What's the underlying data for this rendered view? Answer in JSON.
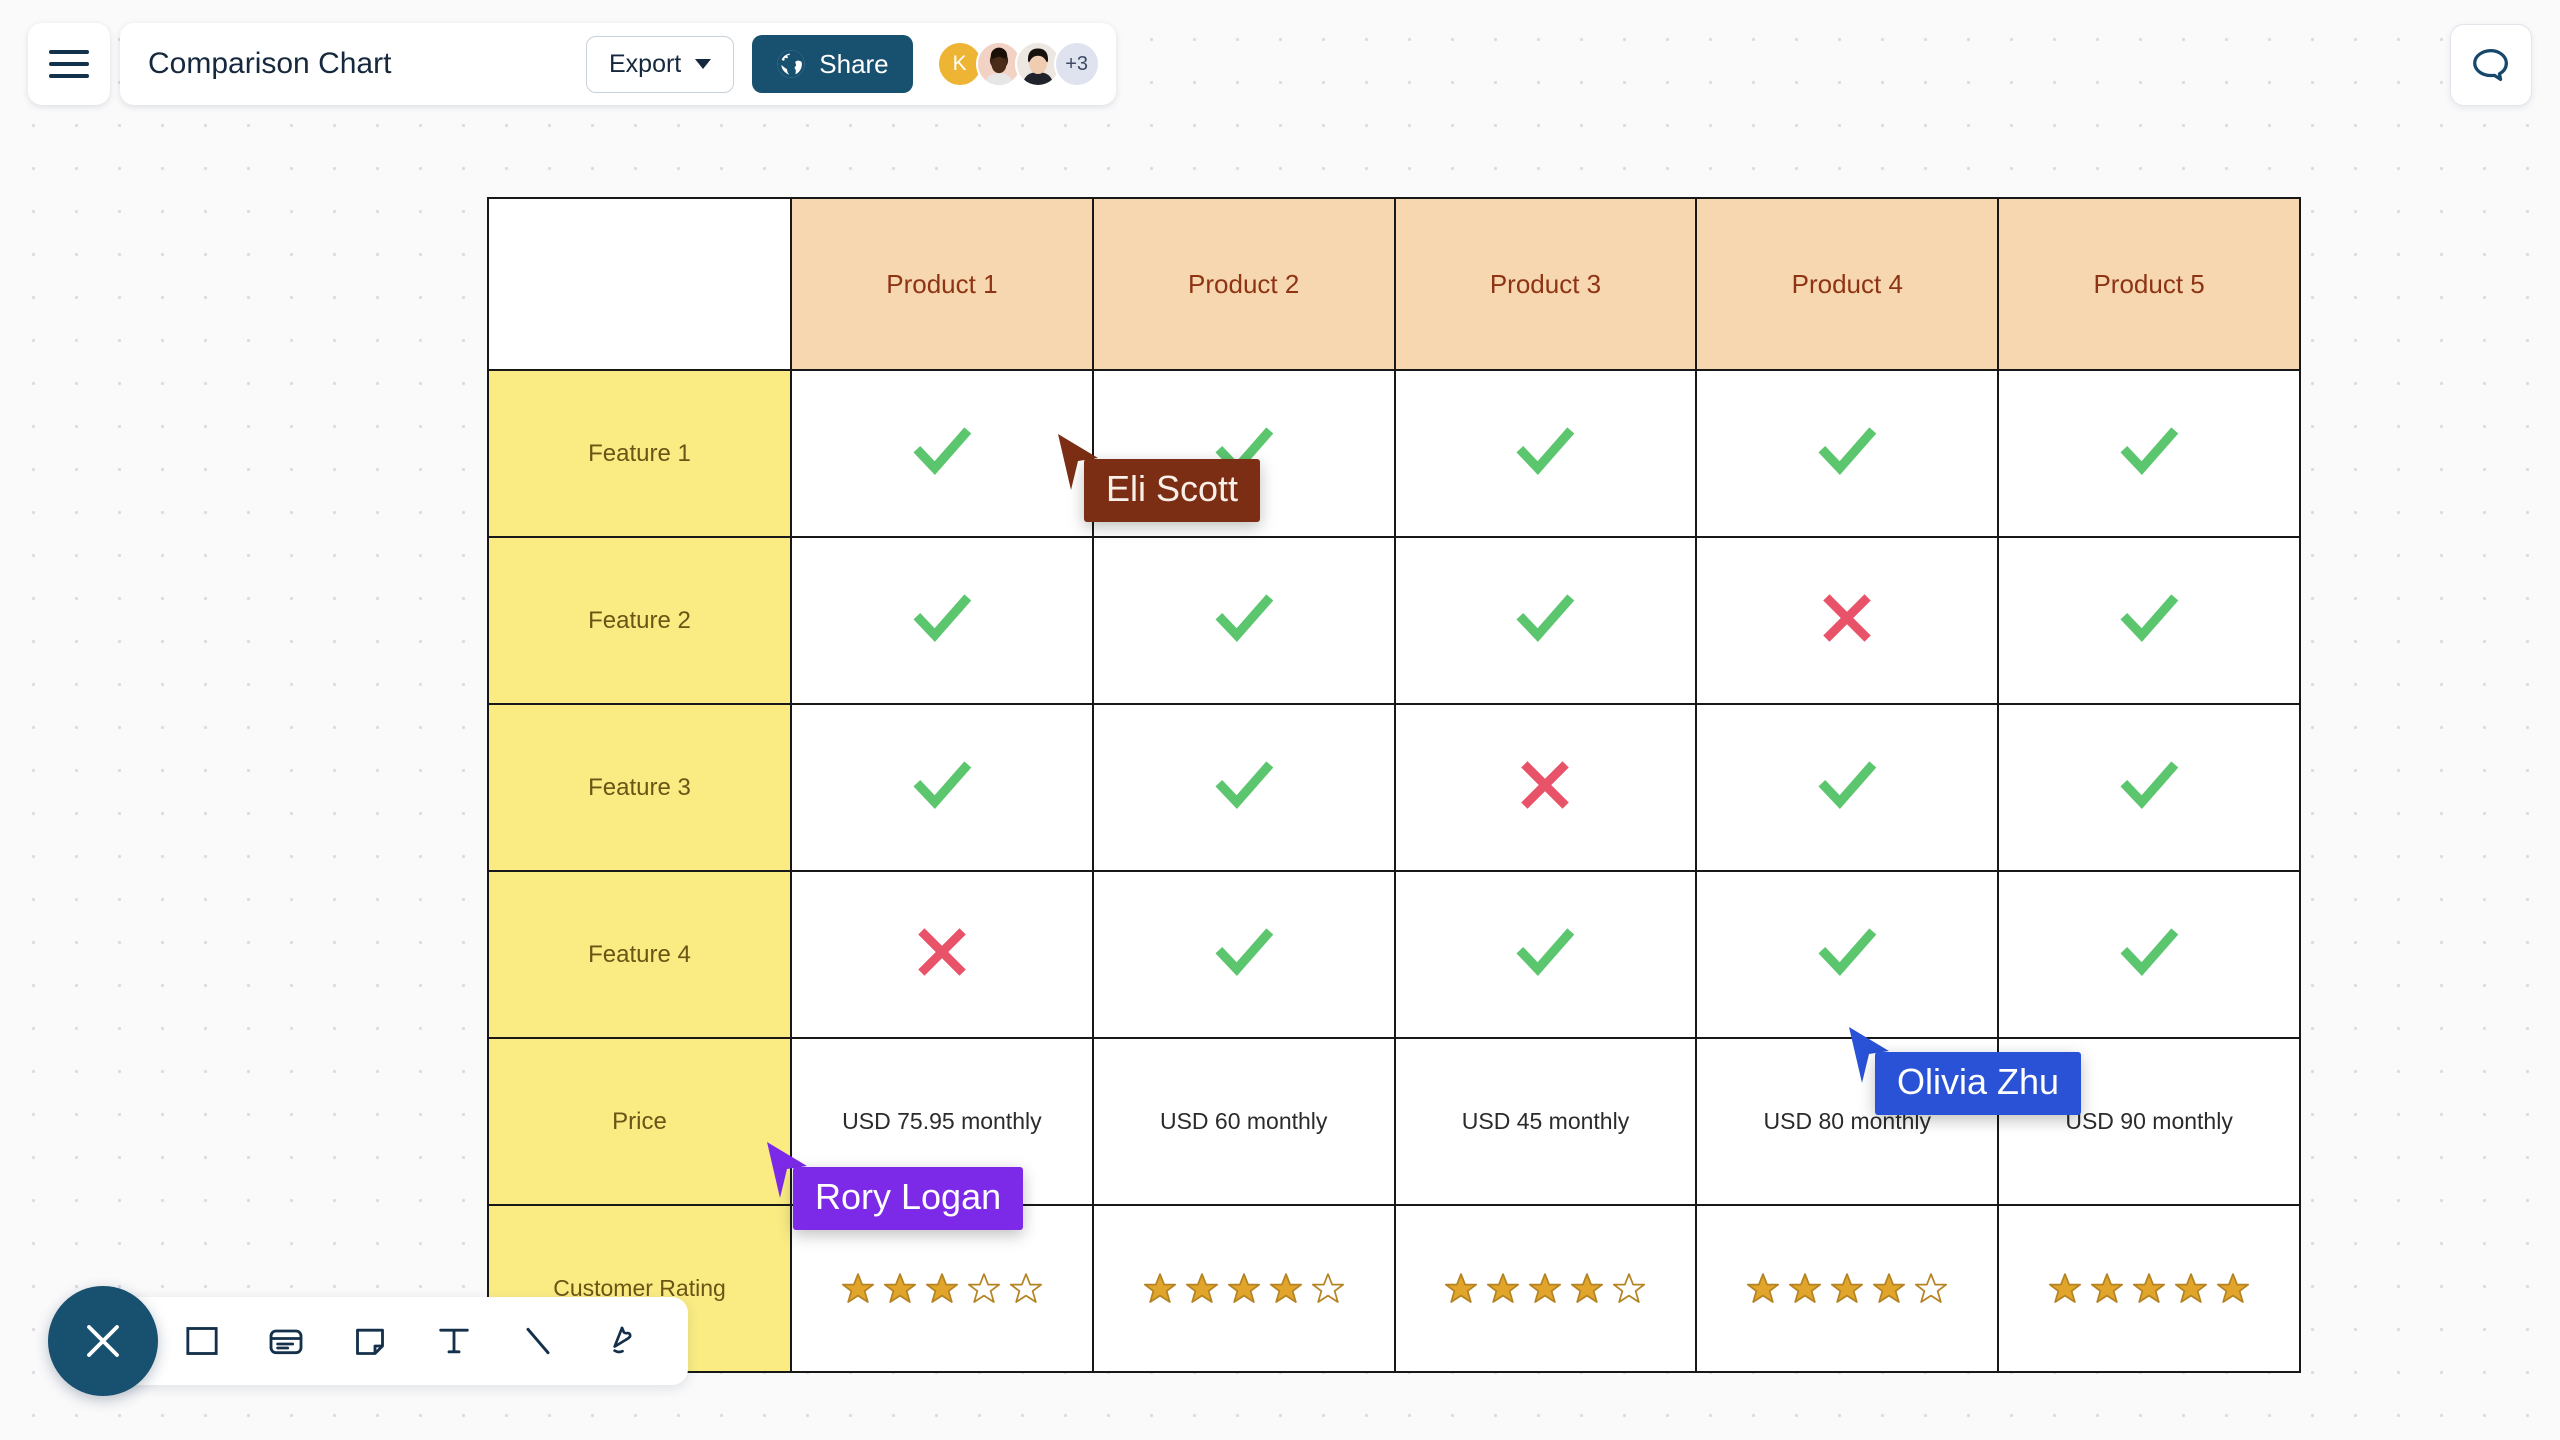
{
  "app": {
    "title": "Comparison Chart"
  },
  "toolbar_top": {
    "menu_icon": "hamburger-menu-icon",
    "export_label": "Export",
    "share_label": "Share",
    "share_icon": "globe-icon",
    "share_bg": "#18506f",
    "comment_icon": "comment-bubble-icon",
    "avatars": [
      {
        "type": "initial",
        "label": "K",
        "color": "#eeb433"
      },
      {
        "type": "photo",
        "label": "",
        "color": "#f0cfc6"
      },
      {
        "type": "photo",
        "label": "",
        "color": "#e6e3de"
      },
      {
        "type": "more",
        "label": "+3",
        "color": "#dfe3ef"
      }
    ]
  },
  "chart_data": {
    "type": "table",
    "title": "Comparison Chart",
    "header_bg": "#F6D7B0",
    "header_text_color": "#8e3415",
    "label_bg": "#FAEC83",
    "label_text_color": "#6b5415",
    "check_color": "#5cc66f",
    "cross_color": "#e8536a",
    "star_color": "#e0a52a",
    "corner_label": "",
    "columns": [
      "Product 1",
      "Product 2",
      "Product 3",
      "Product 4",
      "Product 5"
    ],
    "rows": [
      {
        "label": "Feature 1",
        "kind": "boolean",
        "values": [
          true,
          true,
          true,
          true,
          true
        ]
      },
      {
        "label": "Feature 2",
        "kind": "boolean",
        "values": [
          true,
          true,
          true,
          false,
          true
        ]
      },
      {
        "label": "Feature 3",
        "kind": "boolean",
        "values": [
          true,
          true,
          false,
          true,
          true
        ]
      },
      {
        "label": "Feature 4",
        "kind": "boolean",
        "values": [
          false,
          true,
          true,
          true,
          true
        ]
      },
      {
        "label": "Price",
        "kind": "text",
        "values": [
          "USD 75.95 monthly",
          "USD 60 monthly",
          "USD 45 monthly",
          "USD 80 monthly",
          "USD 90 monthly"
        ]
      },
      {
        "label": "Customer Rating",
        "kind": "rating",
        "max": 5,
        "values": [
          3,
          4,
          4,
          4,
          5
        ]
      }
    ]
  },
  "cursors": [
    {
      "name": "Eli Scott",
      "color": "#7b2e14"
    },
    {
      "name": "Rory Logan",
      "color": "#7c2ae8"
    },
    {
      "name": "Olivia Zhu",
      "color": "#2952d6"
    }
  ],
  "toolbar_bottom": {
    "close_icon": "close-x-icon",
    "tools": [
      {
        "icon": "rectangle-shape-icon",
        "label": "Rectangle"
      },
      {
        "icon": "card-note-icon",
        "label": "Card"
      },
      {
        "icon": "sticky-note-icon",
        "label": "Sticky Note"
      },
      {
        "icon": "text-tool-icon",
        "label": "Text"
      },
      {
        "icon": "line-tool-icon",
        "label": "Line"
      },
      {
        "icon": "marker-pen-icon",
        "label": "Marker"
      }
    ]
  }
}
